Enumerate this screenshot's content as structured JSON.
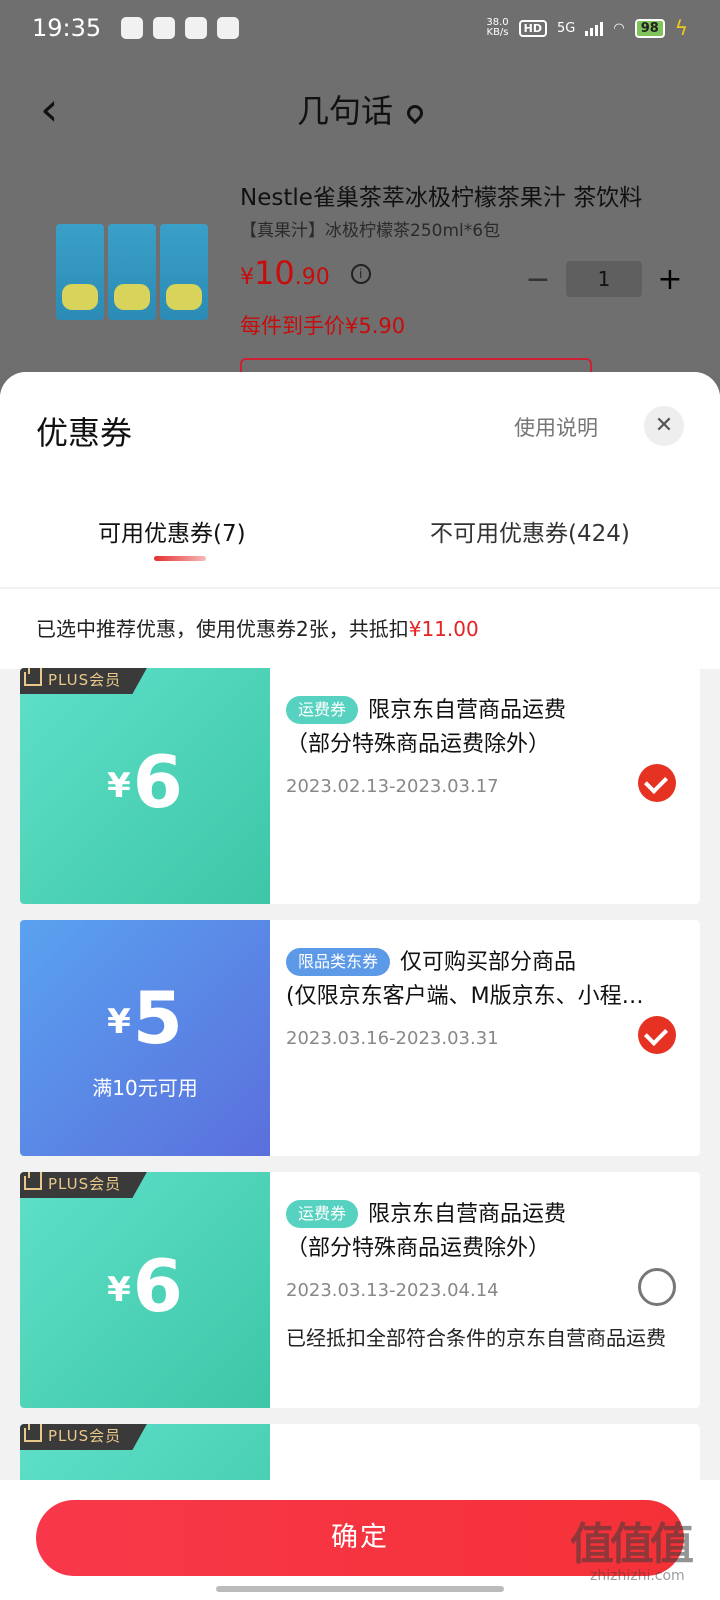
{
  "status": {
    "time": "19:35",
    "net_speed_top": "38.0",
    "net_speed_unit": "KB/s",
    "hd": "HD",
    "network": "5G",
    "battery": "98"
  },
  "header": {
    "title": "几句话"
  },
  "product": {
    "name": "Nestle雀巢茶萃冰极柠檬茶果汁 茶饮料",
    "spec": "【真果汁】冰极柠檬茶250ml*6包",
    "price_symbol": "¥",
    "price_int": "10",
    "price_dec": ".90",
    "quantity": "1",
    "per_item_price": "每件到手价¥5.90"
  },
  "sheet": {
    "title": "优惠券",
    "usage_link": "使用说明",
    "tabs": [
      {
        "label": "可用优惠券(7)"
      },
      {
        "label": "不可用优惠券(424)"
      }
    ],
    "summary_prefix": "已选中推荐优惠，使用优惠券2张，共抵扣",
    "summary_amount": "¥11.00"
  },
  "coupons": [
    {
      "plus_label": "PLUS会员",
      "yen": "¥",
      "amount": "6",
      "type": "运费券",
      "line1": "限京东自营商品运费",
      "line2": "（部分特殊商品运费除外）",
      "date": "2023.02.13-2023.03.17",
      "checked": true
    },
    {
      "yen": "¥",
      "amount": "5",
      "threshold": "满10元可用",
      "type": "限品类东券",
      "line1": "仅可购买部分商品",
      "line2": "(仅限京东客户端、M版京东、小程序)",
      "date": "2023.03.16-2023.03.31",
      "checked": true
    },
    {
      "plus_label": "PLUS会员",
      "yen": "¥",
      "amount": "6",
      "type": "运费券",
      "line1": "限京东自营商品运费",
      "line2": "（部分特殊商品运费除外）",
      "date": "2023.03.13-2023.04.14",
      "note": "已经抵扣全部符合条件的京东自营商品运费",
      "checked": false
    },
    {
      "plus_label": "PLUS会员"
    }
  ],
  "footer": {
    "confirm_label": "确定"
  },
  "watermark": {
    "main": "值值值",
    "sub": "zhizhizhi.com"
  },
  "colors": {
    "accent_red": "#e63222",
    "teal": "#3ec6a7",
    "blue": "#5b6fdc"
  }
}
